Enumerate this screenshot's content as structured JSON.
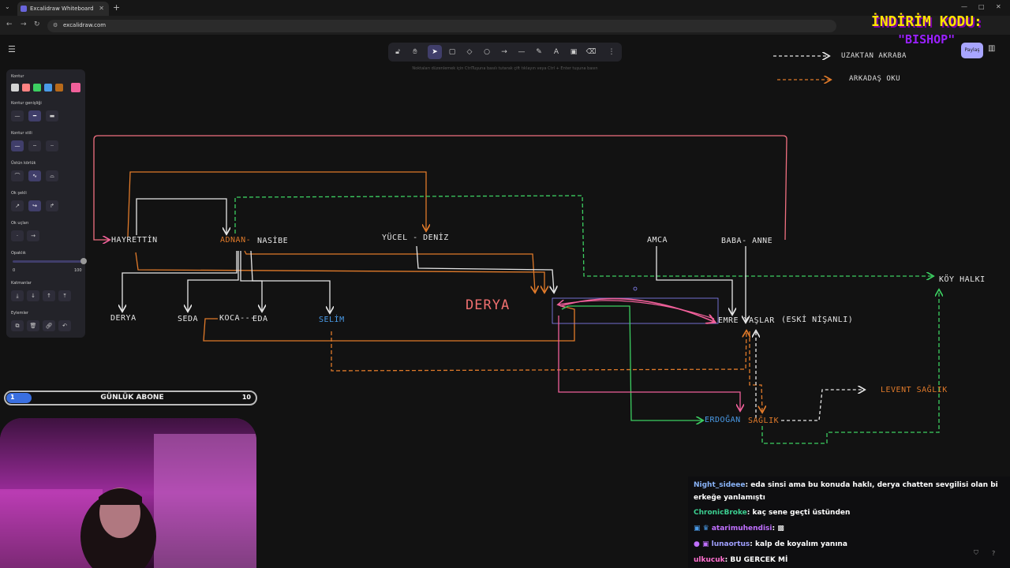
{
  "browser": {
    "tab_title": "Excalidraw Whiteboard",
    "url": "excalidraw.com",
    "tab_close": "✕",
    "new_tab": "+"
  },
  "toolbar": {
    "hint": "Noktaları düzenlemek için CtrlTuşuna basılı tutarak çift tıklayın veya Ctrl + Enter tuşuna basın"
  },
  "properties": {
    "stroke_label": "Kontur",
    "stroke_width_label": "Kontur genişliği",
    "stroke_style_label": "Kontur stili",
    "sloppiness_label": "Üstün körlük",
    "arrow_type_label": "Ok şekli",
    "arrowheads_label": "Ok uçları",
    "opacity_label": "Opaklık",
    "opacity_min": "0",
    "opacity_max": "100",
    "layers_label": "Katmanlar",
    "actions_label": "Eylemler",
    "stroke_colors": [
      "#d4d4d4",
      "#ff8383",
      "#3ccf61",
      "#4a9be8",
      "#b86a1a"
    ],
    "selected_color": "#f0609a"
  },
  "header": {
    "share": "Paylaş"
  },
  "promo": {
    "line1": "İNDİRİM KODU:",
    "line2": "\"BISHOP\""
  },
  "legend": {
    "far_relative": "UZAKTAN AKRABA",
    "friend": "ARKADAŞ OKU"
  },
  "diagram": {
    "nodes": {
      "hayrettin": "HAYRETTİN",
      "adnan": "ADNAN-",
      "nasibe": "NASİBE",
      "yucel_deniz": "YÜCEL - DENİZ",
      "amca": "AMCA",
      "baba_anne": "BABA- ANNE",
      "koy_halki": "KÖY HALKI",
      "derya_small": "DERYA",
      "seda": "SEDA",
      "koca": "KOCA---",
      "eda": "EDA",
      "selim": "SELİM",
      "derya_big": "DERYA",
      "emre": "EMRE YAŞLAR",
      "eski": "(ESKİ NİŞANLI)",
      "levent": "LEVENT SAĞLIK",
      "erdogan": "ERDOĞAN",
      "saglik": "SAĞLIK"
    }
  },
  "subscriber_goal": {
    "label": "GÜNLÜK ABONE",
    "current": "1",
    "goal": "10",
    "progress": 0.1
  },
  "chat": {
    "messages": [
      {
        "user": "Night_sideee",
        "color": "#8ab4f8",
        "text": ": eda sinsi ama bu konuda haklı, derya chatten sevgilisi olan bi erkeğe yanlamıştı"
      },
      {
        "user": "ChronicBroke",
        "color": "#3ccf91",
        "text": ": kaç sene geçti üstünden"
      },
      {
        "user": "atarimuhendisi",
        "color": "#c070ff",
        "text": ":"
      },
      {
        "user": "lunaortus",
        "color": "#a0a0ff",
        "text": ": kalp de koyalım yanına"
      },
      {
        "user": "ulkucuk",
        "color": "#ff70d0",
        "text": ": BU GERCEK Mİ"
      }
    ]
  }
}
